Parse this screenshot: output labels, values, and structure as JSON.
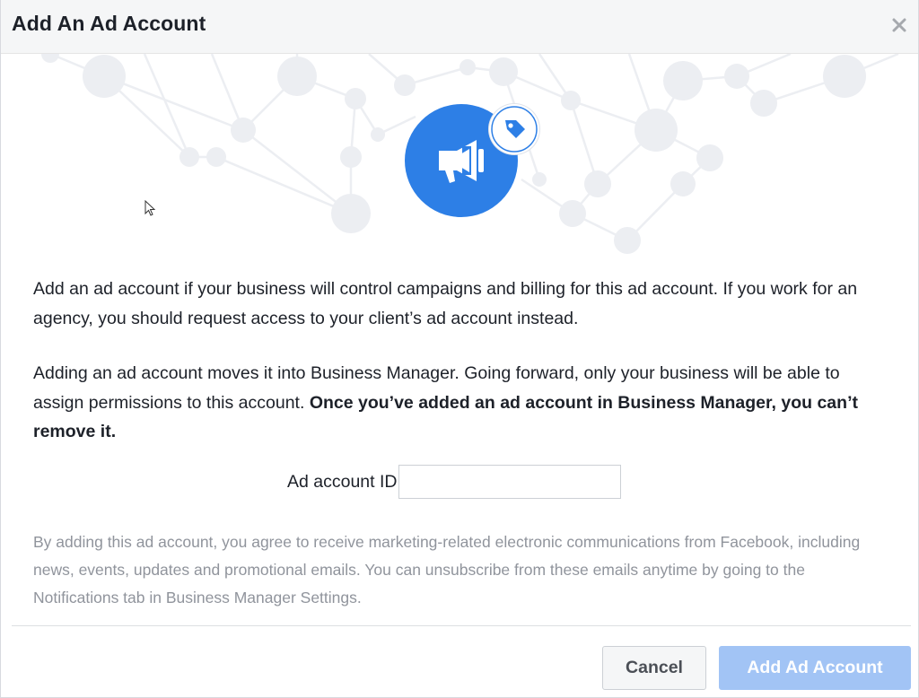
{
  "dialog": {
    "title": "Add An Ad Account",
    "close_icon": "close-icon"
  },
  "hero": {
    "icon": "megaphone-icon",
    "badge_icon": "tag-icon",
    "accent_color": "#2d7fe6"
  },
  "body": {
    "paragraph1": "Add an ad account if your business will control campaigns and billing for this ad account. If you work for an agency, you should request access to your client’s ad account instead.",
    "paragraph2_normal": "Adding an ad account moves it into Business Manager. Going forward, only your business will be able to assign permissions to this account. ",
    "paragraph2_bold": "Once you’ve added an ad account in Business Manager, you can’t remove it."
  },
  "form": {
    "ad_account_id_label": "Ad account ID",
    "ad_account_id_value": "",
    "ad_account_id_placeholder": ""
  },
  "legal": {
    "text": "By adding this ad account, you agree to receive marketing-related electronic communications from Facebook, including news, events, updates and promotional emails. You can unsubscribe from these emails anytime by going to the Notifications tab in Business Manager Settings."
  },
  "footer": {
    "cancel_label": "Cancel",
    "add_label": "Add Ad Account",
    "add_enabled": false
  }
}
